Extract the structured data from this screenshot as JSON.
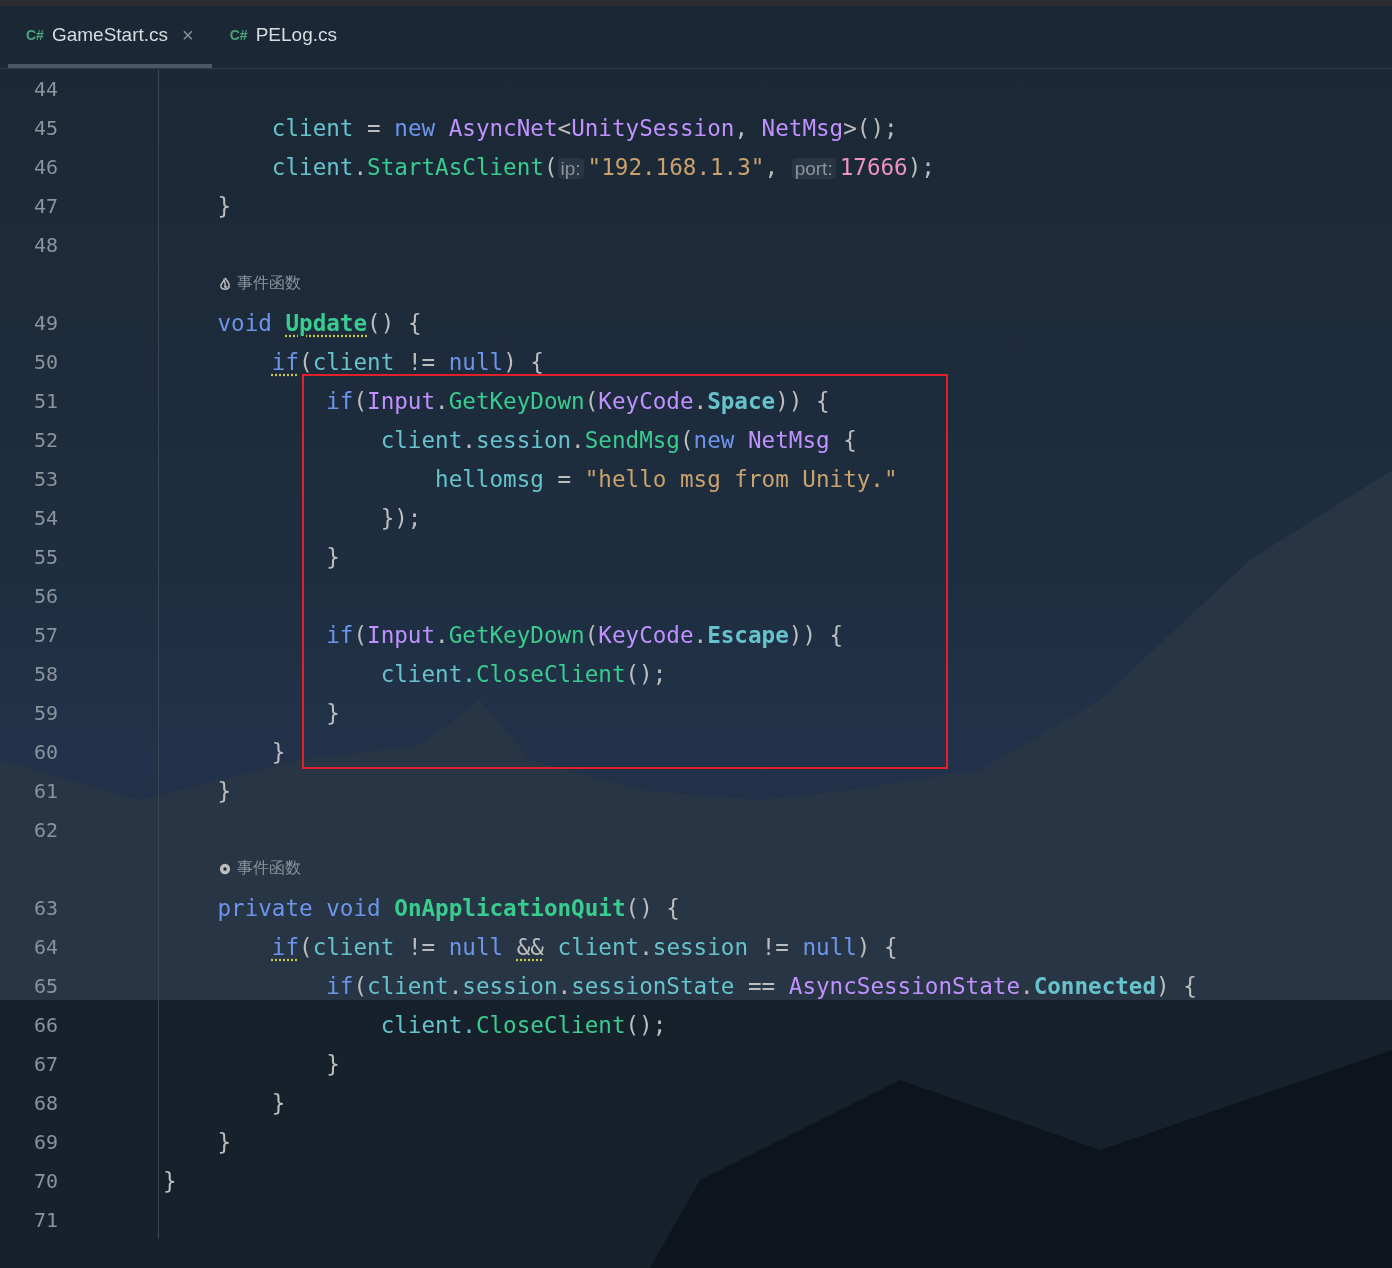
{
  "tabs": [
    {
      "lang": "C#",
      "label": "GameStart.cs",
      "selected": true,
      "close": "×"
    },
    {
      "lang": "C#",
      "label": "PELog.cs",
      "selected": false
    }
  ],
  "lines": [
    {
      "num": "44"
    },
    {
      "num": "45",
      "tokens": [
        {
          "t": "        client",
          "kind": "var"
        },
        {
          "t": " = "
        },
        {
          "t": "new",
          "kind": "kw"
        },
        {
          "t": " AsyncNet",
          "kind": "type"
        },
        {
          "t": "<"
        },
        {
          "t": "UnitySession",
          "kind": "type"
        },
        {
          "t": ", "
        },
        {
          "t": "NetMsg",
          "kind": "type"
        },
        {
          "t": ">();"
        }
      ]
    },
    {
      "num": "46",
      "tokens": [
        {
          "t": "        client",
          "kind": "var"
        },
        {
          "t": "."
        },
        {
          "t": "StartAsClient",
          "kind": "method"
        },
        {
          "t": "("
        },
        {
          "t": "ip:",
          "kind": "hint"
        },
        {
          "t": "\"192.168.1.3\"",
          "kind": "str"
        },
        {
          "t": ", "
        },
        {
          "t": "port:",
          "kind": "hint"
        },
        {
          "t": "17666",
          "kind": "num"
        },
        {
          "t": ");"
        }
      ]
    },
    {
      "num": "47",
      "tokens": [
        {
          "t": "    }"
        }
      ]
    },
    {
      "num": "48"
    },
    {
      "note": {
        "kind": "flame",
        "text": "事件函数"
      }
    },
    {
      "num": "49",
      "tokens": [
        {
          "t": "    void",
          "kind": "kw"
        },
        {
          "t": " Update",
          "kind": "method",
          "bold": true,
          "warn": true
        },
        {
          "t": "() {"
        }
      ]
    },
    {
      "num": "50",
      "tokens": [
        {
          "t": "        if",
          "kind": "kw",
          "warn": true
        },
        {
          "t": "("
        },
        {
          "t": "client",
          "kind": "var"
        },
        {
          "t": " != "
        },
        {
          "t": "null",
          "kind": "kw"
        },
        {
          "t": ") {"
        }
      ]
    },
    {
      "num": "51",
      "tokens": [
        {
          "t": "            if",
          "kind": "kw"
        },
        {
          "t": "("
        },
        {
          "t": "Input",
          "kind": "type"
        },
        {
          "t": "."
        },
        {
          "t": "GetKeyDown",
          "kind": "method"
        },
        {
          "t": "("
        },
        {
          "t": "KeyCode",
          "kind": "type"
        },
        {
          "t": "."
        },
        {
          "t": "Space",
          "kind": "var",
          "bold": true
        },
        {
          "t": ")) {"
        }
      ]
    },
    {
      "num": "52",
      "tokens": [
        {
          "t": "                client",
          "kind": "var"
        },
        {
          "t": "."
        },
        {
          "t": "session",
          "kind": "var"
        },
        {
          "t": "."
        },
        {
          "t": "SendMsg",
          "kind": "method"
        },
        {
          "t": "("
        },
        {
          "t": "new",
          "kind": "kw"
        },
        {
          "t": " NetMsg",
          "kind": "type"
        },
        {
          "t": " {"
        }
      ]
    },
    {
      "num": "53",
      "tokens": [
        {
          "t": "                    hellomsg",
          "kind": "var"
        },
        {
          "t": " = "
        },
        {
          "t": "\"hello msg from Unity.\"",
          "kind": "str"
        }
      ]
    },
    {
      "num": "54",
      "tokens": [
        {
          "t": "                });"
        }
      ]
    },
    {
      "num": "55",
      "tokens": [
        {
          "t": "            }"
        }
      ]
    },
    {
      "num": "56"
    },
    {
      "num": "57",
      "tokens": [
        {
          "t": "            if",
          "kind": "kw"
        },
        {
          "t": "("
        },
        {
          "t": "Input",
          "kind": "type"
        },
        {
          "t": "."
        },
        {
          "t": "GetKeyDown",
          "kind": "method"
        },
        {
          "t": "("
        },
        {
          "t": "KeyCode",
          "kind": "type"
        },
        {
          "t": "."
        },
        {
          "t": "Escape",
          "kind": "var",
          "bold": true
        },
        {
          "t": ")) {"
        }
      ]
    },
    {
      "num": "58",
      "tokens": [
        {
          "t": "                client.",
          "kind": "var"
        },
        {
          "t": "CloseClient",
          "kind": "method"
        },
        {
          "t": "();"
        }
      ]
    },
    {
      "num": "59",
      "tokens": [
        {
          "t": "            }"
        }
      ]
    },
    {
      "num": "60",
      "tokens": [
        {
          "t": "        }"
        }
      ]
    },
    {
      "num": "61",
      "tokens": [
        {
          "t": "    }"
        }
      ]
    },
    {
      "num": "62"
    },
    {
      "note": {
        "kind": "unity",
        "text": "事件函数"
      }
    },
    {
      "num": "63",
      "tokens": [
        {
          "t": "    private",
          "kind": "kw"
        },
        {
          "t": " void",
          "kind": "kw"
        },
        {
          "t": " OnApplicationQuit",
          "kind": "method",
          "bold": true
        },
        {
          "t": "() {"
        }
      ]
    },
    {
      "num": "64",
      "tokens": [
        {
          "t": "        if",
          "kind": "kw",
          "warn": true
        },
        {
          "t": "("
        },
        {
          "t": "client",
          "kind": "var"
        },
        {
          "t": " != "
        },
        {
          "t": "null",
          "kind": "kw"
        },
        {
          "t": " &&",
          "warn": true
        },
        {
          "t": " client",
          "kind": "var"
        },
        {
          "t": "."
        },
        {
          "t": "session",
          "kind": "var"
        },
        {
          "t": " != "
        },
        {
          "t": "null",
          "kind": "kw"
        },
        {
          "t": ") {"
        }
      ]
    },
    {
      "num": "65",
      "tokens": [
        {
          "t": "            if",
          "kind": "kw"
        },
        {
          "t": "("
        },
        {
          "t": "client",
          "kind": "var"
        },
        {
          "t": "."
        },
        {
          "t": "session",
          "kind": "var"
        },
        {
          "t": "."
        },
        {
          "t": "sessionState",
          "kind": "var"
        },
        {
          "t": " == "
        },
        {
          "t": "AsyncSessionState",
          "kind": "type"
        },
        {
          "t": "."
        },
        {
          "t": "Connected",
          "kind": "var",
          "bold": true
        },
        {
          "t": ") {"
        }
      ]
    },
    {
      "num": "66",
      "tokens": [
        {
          "t": "                client.",
          "kind": "var"
        },
        {
          "t": "CloseClient",
          "kind": "method"
        },
        {
          "t": "();"
        }
      ]
    },
    {
      "num": "67",
      "tokens": [
        {
          "t": "            }"
        }
      ]
    },
    {
      "num": "68",
      "tokens": [
        {
          "t": "        }"
        }
      ]
    },
    {
      "num": "69",
      "tokens": [
        {
          "t": "    }"
        }
      ]
    },
    {
      "num": "70",
      "tokens": [
        {
          "t": "}"
        }
      ]
    },
    {
      "num": "71"
    }
  ]
}
